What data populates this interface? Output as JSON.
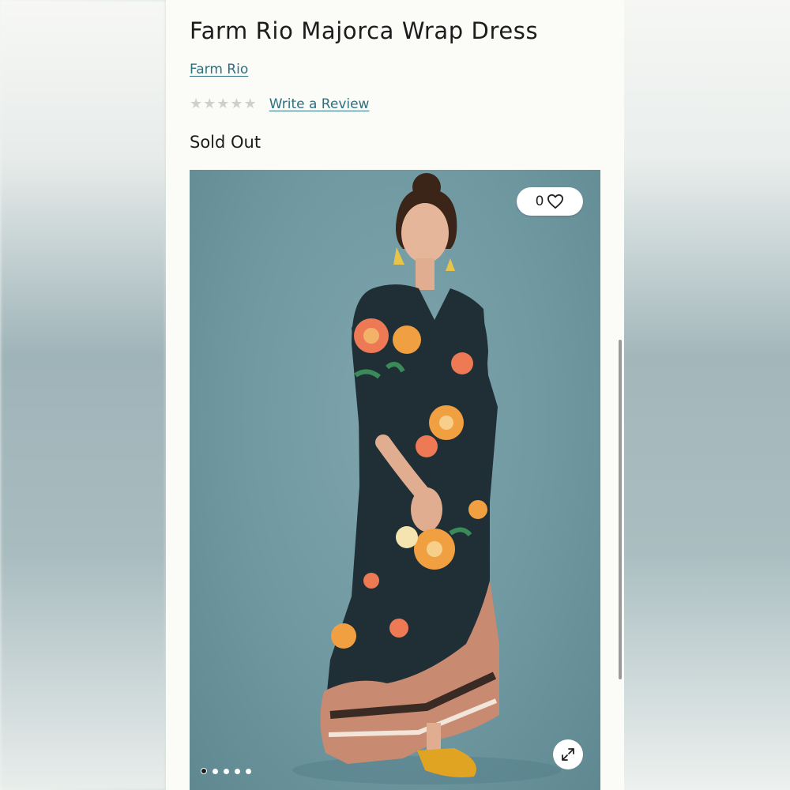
{
  "product": {
    "title": "Farm Rio Majorca Wrap Dress",
    "brand": "Farm Rio",
    "rating": {
      "stars": 0,
      "max_stars": 5,
      "review_link": "Write a Review"
    },
    "status": "Sold Out"
  },
  "gallery": {
    "like_count": "0",
    "like_icon": "heart-outline-icon",
    "expand_icon": "expand-arrows-icon",
    "image_count": 5,
    "active_index": 0
  },
  "colors": {
    "link": "#2e6f80",
    "image_background": "#7aa1a9",
    "dress_dark": "#1f2f35",
    "flower_orange": "#f0a040",
    "flower_coral": "#ee7a55",
    "shoe_mustard": "#e0a422"
  }
}
